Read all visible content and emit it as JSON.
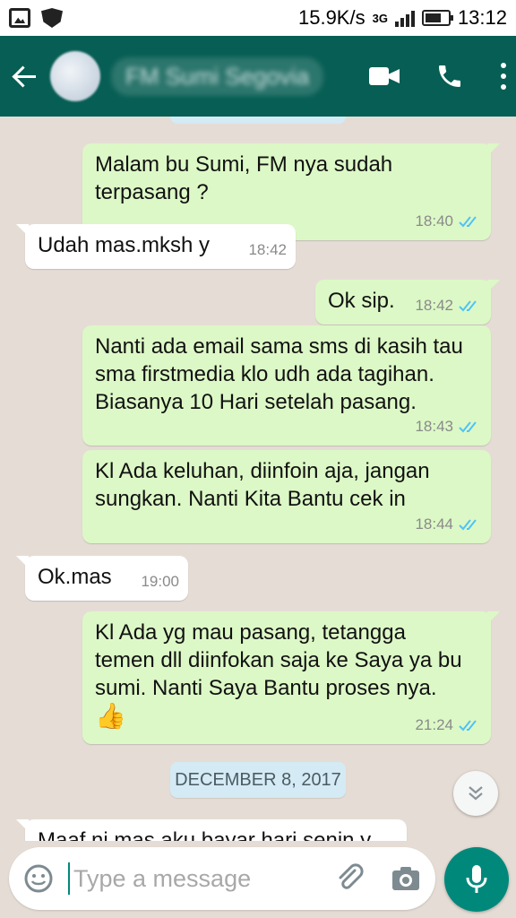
{
  "status_bar": {
    "speed": "15.9K/s",
    "network": "3G",
    "time": "13:12"
  },
  "header": {
    "contact_name": "FM Sumi Segovia"
  },
  "messages": [
    {
      "direction": "out",
      "text": "Malam bu Sumi, FM nya sudah terpasang ?",
      "time": "18:40"
    },
    {
      "direction": "in",
      "text": "Udah mas.mksh y",
      "time": "18:42"
    },
    {
      "direction": "out",
      "text": "Ok sip.",
      "time": "18:42"
    },
    {
      "direction": "out",
      "text": "Nanti ada email sama sms di kasih tau sma firstmedia klo udh ada tagihan. Biasanya 10 Hari setelah pasang.",
      "time": "18:43"
    },
    {
      "direction": "out",
      "text": "Kl Ada keluhan, diinfoin aja, jangan sungkan. Nanti Kita Bantu cek in",
      "time": "18:44"
    },
    {
      "direction": "in",
      "text": "Ok.mas",
      "time": "19:00"
    },
    {
      "direction": "out",
      "text": "Kl Ada yg mau pasang, tetangga temen dll diinfokan saja ke Saya ya bu sumi. Nanti Saya Bantu proses nya.",
      "emoji": "👍",
      "time": "21:24"
    },
    {
      "direction": "in",
      "text": "Maaf ni mas aku bayar hari senin y"
    }
  ],
  "date_divider": "DECEMBER 8, 2017",
  "composer": {
    "placeholder": "Type a message"
  },
  "colors": {
    "header": "#075e54",
    "outgoing_bubble": "#dcf8c6",
    "incoming_bubble": "#ffffff",
    "accent": "#00897b",
    "read_ticks": "#4fc3f7"
  }
}
